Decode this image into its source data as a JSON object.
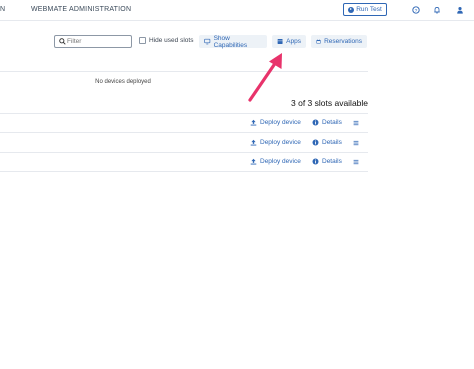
{
  "header": {
    "nav_fragment": "N",
    "nav_admin": "WEBMATE ADMINISTRATION",
    "run_test_label": "Run Test",
    "icons": [
      "help-icon",
      "bell-icon",
      "user-icon"
    ]
  },
  "toolbar": {
    "filter_placeholder": "Filter",
    "hide_used_slots_label": "Hide used slots",
    "show_capabilities_label": "Show Capabilities",
    "apps_label": "Apps",
    "reservations_label": "Reservations"
  },
  "main": {
    "no_devices_text": "No devices deployed",
    "slots_available_text": "3 of 3 slots available",
    "slots": [
      {
        "deploy_label": "Deploy device",
        "details_label": "Details"
      },
      {
        "deploy_label": "Deploy device",
        "details_label": "Details"
      },
      {
        "deploy_label": "Deploy device",
        "details_label": "Details"
      }
    ]
  },
  "colors": {
    "accent": "#2f67b5",
    "pill_bg": "#edf2f7",
    "annotation_arrow": "#e8336b"
  }
}
